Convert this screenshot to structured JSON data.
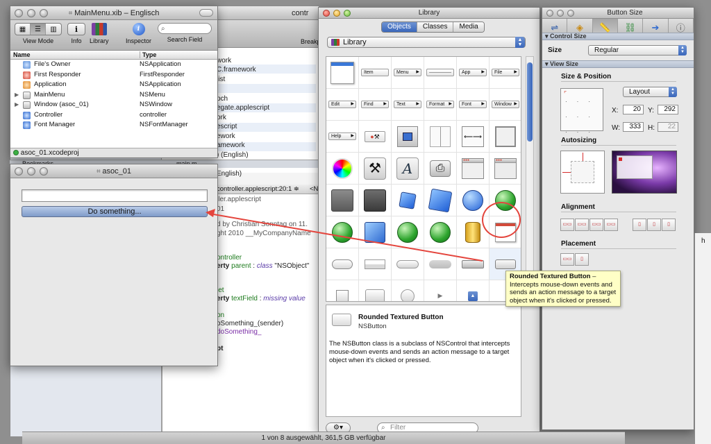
{
  "mainmenu": {
    "title": "MainMenu.xib – Englisch",
    "toolbar": {
      "view_mode": "View Mode",
      "info": "Info",
      "library": "Library",
      "inspector": "Inspector",
      "search_field": "Search Field"
    },
    "columns": {
      "name": "Name",
      "type": "Type"
    },
    "rows": [
      {
        "name": "File's Owner",
        "type": "NSApplication"
      },
      {
        "name": "First Responder",
        "type": "FirstResponder"
      },
      {
        "name": "Application",
        "type": "NSApplication"
      },
      {
        "name": "MainMenu",
        "type": "NSMenu"
      },
      {
        "name": "Window (asoc_01)",
        "type": "NSWindow"
      },
      {
        "name": "Controller",
        "type": "controller"
      },
      {
        "name": "Font Manager",
        "type": "NSFontManager"
      }
    ],
    "status": "asoc_01.xcodeproj"
  },
  "background": {
    "title_partial": "contr",
    "breakpoint_label": "Breakp",
    "bookmarks": "Bookmarks",
    "main_tab": "main.m",
    "lines": [
      "work",
      "C.framework",
      "list",
      "pch",
      "egate.applescript",
      "ork",
      "escript",
      "ework",
      "amework",
      ") (English)",
      "English)"
    ],
    "editor_path": "controller.applescript:20:1 ≑",
    "code": {
      "l1": "ller.applescript",
      "l2": "01",
      "l3": "d by Christian Sonntag on 11.",
      "l4": "ght 2010 __MyCompanyName",
      "l5": "ontroller",
      "l6_kw": "erty",
      "l6_a": "parent",
      "l6_b": ":",
      "l6_c": "class",
      "l6_d": "\"NSObject\"",
      "l7": "let",
      "l8_kw": "erty",
      "l8_a": "textField",
      "l8_b": ":",
      "l8_c": "missing value",
      "l9": "on",
      "l10": "oSomething_(sender)",
      "l11": "doSomething_",
      "l12": "pt"
    }
  },
  "asoc": {
    "title": "asoc_01",
    "button_label": "Do something..."
  },
  "library": {
    "title": "Library",
    "tabs": [
      "Objects",
      "Classes",
      "Media"
    ],
    "popup": "Library",
    "grid_labels": {
      "item": "Item",
      "menu": "Menu",
      "app": "App",
      "file": "File",
      "edit": "Edit",
      "find": "Find",
      "text": "Text",
      "format": "Format",
      "font": "Font",
      "window": "Window",
      "help": "Help"
    },
    "detail": {
      "title": "Rounded Textured Button",
      "class": "NSButton",
      "description": "The NSButton class is a subclass of NSControl that intercepts mouse-down events and sends an action message to a target object when it's clicked or pressed."
    },
    "filter_placeholder": "Filter"
  },
  "tooltip": {
    "title": "Rounded Textured Button",
    "dash": " –",
    "body": "Intercepts mouse-down events and sends an action message to a target object when it's clicked or pressed."
  },
  "inspector": {
    "title": "Button Size",
    "control_size_header": "Control Size",
    "size_label": "Size",
    "size_value": "Regular",
    "view_size_header": "View Size",
    "size_position": "Size & Position",
    "layout": "Layout",
    "x_label": "X:",
    "x_value": "20",
    "y_label": "Y:",
    "y_value": "292",
    "w_label": "W:",
    "w_value": "333",
    "h_label": "H:",
    "h_value": "22",
    "autosizing": "Autosizing",
    "alignment": "Alignment",
    "placement": "Placement"
  },
  "finder_status": "1 von 8 ausgewählt, 361,5 GB verfügbar",
  "colors": {
    "accent": "#3a67bb",
    "highlight": "#e4453d",
    "tooltip": "#ffffc6"
  }
}
